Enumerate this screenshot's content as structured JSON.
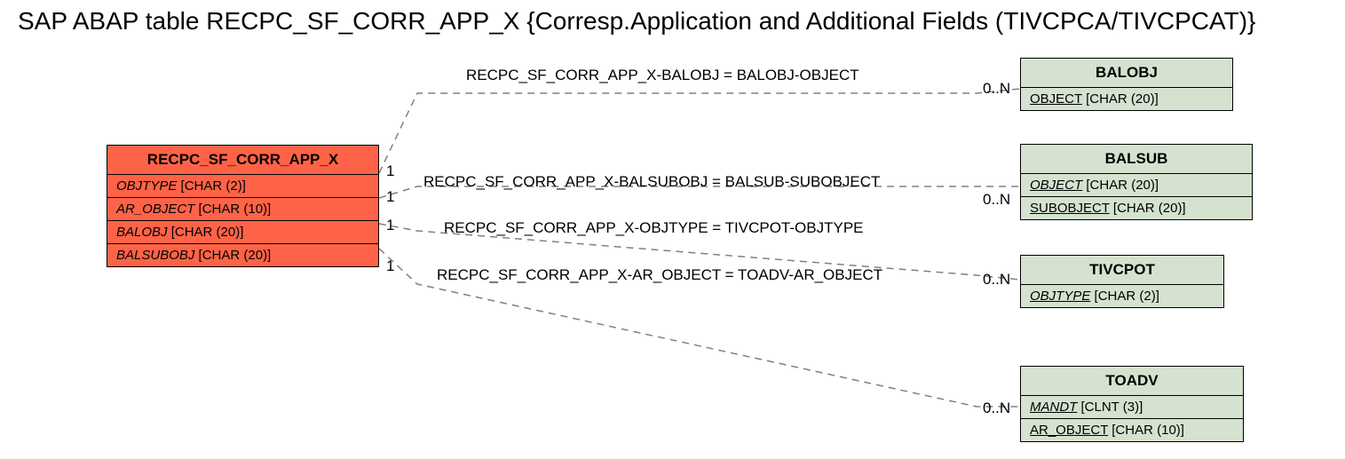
{
  "title": "SAP ABAP table RECPC_SF_CORR_APP_X {Corresp.Application and Additional Fields (TIVCPCA/TIVCPCAT)}",
  "main_entity": {
    "name": "RECPC_SF_CORR_APP_X",
    "fields": [
      {
        "name": "OBJTYPE",
        "type": "[CHAR (2)]"
      },
      {
        "name": "AR_OBJECT",
        "type": "[CHAR (10)]"
      },
      {
        "name": "BALOBJ",
        "type": "[CHAR (20)]"
      },
      {
        "name": "BALSUBOBJ",
        "type": "[CHAR (20)]"
      }
    ]
  },
  "related": {
    "balobj": {
      "name": "BALOBJ",
      "fields": [
        {
          "name": "OBJECT",
          "type": "[CHAR (20)]",
          "underline": true
        }
      ]
    },
    "balsub": {
      "name": "BALSUB",
      "fields": [
        {
          "name": "OBJECT",
          "type": "[CHAR (20)]",
          "underline": true,
          "italic": true
        },
        {
          "name": "SUBOBJECT",
          "type": "[CHAR (20)]",
          "underline": true
        }
      ]
    },
    "tivcpot": {
      "name": "TIVCPOT",
      "fields": [
        {
          "name": "OBJTYPE",
          "type": "[CHAR (2)]",
          "underline": true,
          "italic": true
        }
      ]
    },
    "toadv": {
      "name": "TOADV",
      "fields": [
        {
          "name": "MANDT",
          "type": "[CLNT (3)]",
          "underline": true,
          "italic": true
        },
        {
          "name": "AR_OBJECT",
          "type": "[CHAR (10)]",
          "underline": true
        }
      ]
    }
  },
  "relations": [
    {
      "label": "RECPC_SF_CORR_APP_X-BALOBJ = BALOBJ-OBJECT",
      "left_card": "1",
      "right_card": "0..N"
    },
    {
      "label": "RECPC_SF_CORR_APP_X-BALSUBOBJ = BALSUB-SUBOBJECT",
      "left_card": "1",
      "right_card": "0..N"
    },
    {
      "label": "RECPC_SF_CORR_APP_X-OBJTYPE = TIVCPOT-OBJTYPE",
      "left_card": "1",
      "right_card": "0..N"
    },
    {
      "label": "RECPC_SF_CORR_APP_X-AR_OBJECT = TOADV-AR_OBJECT",
      "left_card": "1",
      "right_card": "0..N"
    }
  ]
}
